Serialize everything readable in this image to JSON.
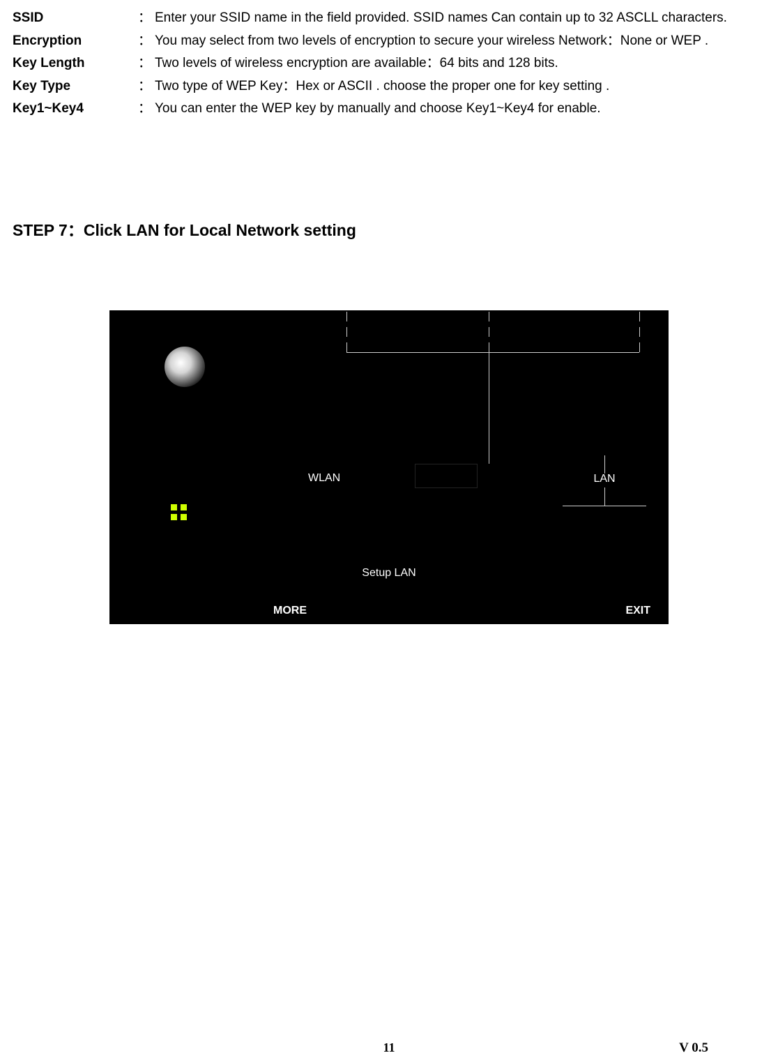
{
  "defs": [
    {
      "term": "SSID",
      "text": "Enter your SSID name in the field provided. SSID names Can contain up to 32 ASCLL characters."
    },
    {
      "term": "Encryption",
      "text": "You may select from two levels of encryption to secure your wireless Network：None or WEP ."
    },
    {
      "term": "Key Length",
      "text": "Two levels of wireless encryption are available：64 bits and 128 bits."
    },
    {
      "term": "Key Type",
      "text": "Two type of WEP Key：Hex or ASCII . choose the proper one for key setting ."
    },
    {
      "term": "Key1~Key4",
      "text": "You can enter the WEP key by manually and choose Key1~Key4 for enable."
    }
  ],
  "step_heading": "STEP 7：Click LAN for Local Network setting",
  "diagram": {
    "wlan": "WLAN",
    "lan": "LAN",
    "setup": "Setup LAN",
    "more": "MORE",
    "exit": "EXIT"
  },
  "footer": {
    "page": "11",
    "version": "V 0.5"
  }
}
